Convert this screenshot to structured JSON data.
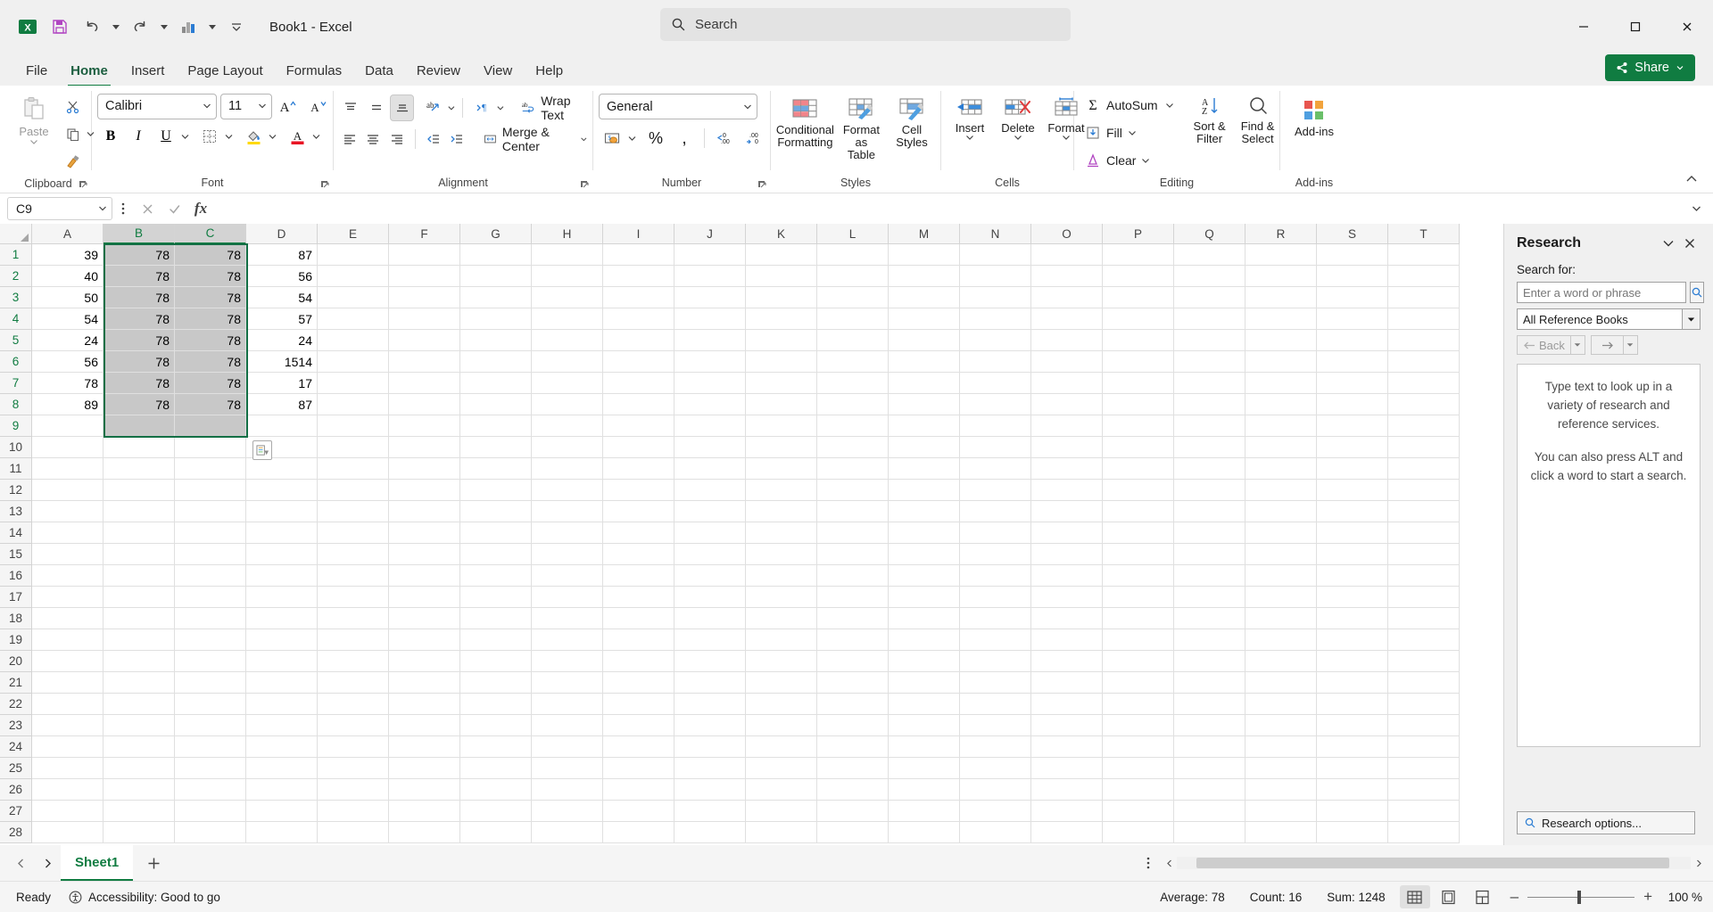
{
  "window": {
    "title": "Book1  -  Excel",
    "app_icon": "excel-icon",
    "search_placeholder": "Search",
    "minimize": "–",
    "maximize": "□",
    "close": "✕"
  },
  "quick_access": [
    {
      "name": "save",
      "icon": "save-icon"
    },
    {
      "name": "undo",
      "icon": "undo-icon"
    },
    {
      "name": "redo",
      "icon": "redo-icon"
    },
    {
      "name": "chart",
      "icon": "chart-icon"
    },
    {
      "name": "customize",
      "icon": "customize-qat-icon"
    }
  ],
  "tabs": [
    {
      "label": "File",
      "active": false
    },
    {
      "label": "Home",
      "active": true
    },
    {
      "label": "Insert",
      "active": false
    },
    {
      "label": "Page Layout",
      "active": false
    },
    {
      "label": "Formulas",
      "active": false
    },
    {
      "label": "Data",
      "active": false
    },
    {
      "label": "Review",
      "active": false
    },
    {
      "label": "View",
      "active": false
    },
    {
      "label": "Help",
      "active": false
    }
  ],
  "share_label": "Share",
  "ribbon": {
    "groups": {
      "clipboard": {
        "label": "Clipboard",
        "paste": "Paste",
        "cut": "Cut",
        "copy": "Copy",
        "format_painter": "Format Painter"
      },
      "font": {
        "label": "Font",
        "font_name": "Calibri",
        "font_size": "11",
        "grow": "Increase Font Size",
        "shrink": "Decrease Font Size",
        "bold": "B",
        "italic": "I",
        "underline": "U",
        "borders": "Borders",
        "fill_color": "Fill Color",
        "font_color": "Font Color"
      },
      "alignment": {
        "label": "Alignment",
        "wrap_text": "Wrap Text",
        "merge_center": "Merge & Center",
        "orientation": "Orientation",
        "ltr": "Text Direction",
        "decrease_indent": "Decrease Indent",
        "increase_indent": "Increase Indent"
      },
      "number": {
        "label": "Number",
        "format": "General",
        "accounting": "Accounting Number Format",
        "percent": "%",
        "comma": ",",
        "increase_decimal": "Increase Decimal",
        "decrease_decimal": "Decrease Decimal"
      },
      "styles": {
        "label": "Styles",
        "conditional_formatting": "Conditional\nFormatting",
        "conditional_formatting_l1": "Conditional",
        "conditional_formatting_l2": "Formatting",
        "format_as_table_l1": "Format as",
        "format_as_table_l2": "Table",
        "cell_styles_l1": "Cell",
        "cell_styles_l2": "Styles"
      },
      "cells": {
        "label": "Cells",
        "insert": "Insert",
        "delete": "Delete",
        "format": "Format"
      },
      "editing": {
        "label": "Editing",
        "autosum": "AutoSum",
        "fill": "Fill",
        "clear": "Clear",
        "sort_filter_l1": "Sort &",
        "sort_filter_l2": "Filter",
        "find_select_l1": "Find &",
        "find_select_l2": "Select"
      },
      "addins": {
        "label": "Add-ins",
        "button": "Add-ins"
      }
    }
  },
  "formula_bar": {
    "name_box": "C9",
    "value": "",
    "cancel_icon": "cancel-icon",
    "enter_icon": "enter-icon",
    "fx_icon": "insert-function-icon"
  },
  "grid": {
    "columns": [
      "A",
      "B",
      "C",
      "D",
      "E",
      "F",
      "G",
      "H",
      "I",
      "J",
      "K",
      "L",
      "M",
      "N",
      "O",
      "P",
      "Q",
      "R",
      "S",
      "T"
    ],
    "rows": [
      1,
      2,
      3,
      4,
      5,
      6,
      7,
      8,
      9,
      10,
      11,
      12,
      13,
      14,
      15,
      16,
      17,
      18,
      19,
      20,
      21,
      22,
      23,
      24,
      25,
      26,
      27,
      28
    ],
    "selection_range": "B1:C9",
    "selected_columns": [
      "B",
      "C"
    ],
    "data": [
      {
        "row": 1,
        "A": "39",
        "B": "78",
        "C": "78",
        "D": "87"
      },
      {
        "row": 2,
        "A": "40",
        "B": "78",
        "C": "78",
        "D": "56"
      },
      {
        "row": 3,
        "A": "50",
        "B": "78",
        "C": "78",
        "D": "54"
      },
      {
        "row": 4,
        "A": "54",
        "B": "78",
        "C": "78",
        "D": "57"
      },
      {
        "row": 5,
        "A": "24",
        "B": "78",
        "C": "78",
        "D": "24"
      },
      {
        "row": 6,
        "A": "56",
        "B": "78",
        "C": "78",
        "D": "1514"
      },
      {
        "row": 7,
        "A": "78",
        "B": "78",
        "C": "78",
        "D": "17"
      },
      {
        "row": 8,
        "A": "89",
        "B": "78",
        "C": "78",
        "D": "87"
      }
    ],
    "paste_options_icon": "paste-options-icon"
  },
  "task_pane": {
    "title": "Research",
    "collapse_icon": "chevron-down-icon",
    "close_icon": "close-icon",
    "search_label": "Search for:",
    "search_placeholder": "Enter a word or phrase",
    "search_value": "",
    "go_icon": "search-go-icon",
    "reference_source": "All Reference Books",
    "back_label": "Back",
    "forward_label": "",
    "body_paragraph_1": "Type text to look up in a variety of research and reference services.",
    "body_paragraph_2": "You can also press ALT and click a word to start a search.",
    "options_label": "Research options..."
  },
  "sheet_bar": {
    "prev": "‹",
    "next": "›",
    "sheets": [
      {
        "label": "Sheet1",
        "active": true
      }
    ],
    "add_sheet": "+",
    "more": "⋮"
  },
  "status_bar": {
    "ready": "Ready",
    "accessibility": "Accessibility: Good to go",
    "average": "Average: 78",
    "count": "Count: 16",
    "sum": "Sum: 1248",
    "views": [
      {
        "name": "normal-view",
        "active": true
      },
      {
        "name": "page-layout-view",
        "active": false
      },
      {
        "name": "page-break-view",
        "active": false
      }
    ],
    "zoom_out": "–",
    "zoom_in": "+",
    "zoom_level": "100 %"
  },
  "colors": {
    "accent": "#107c41",
    "selection_border": "#136f45",
    "selection_fill": "#c8c8c8",
    "ribbon_bg": "#ffffff",
    "chrome_bg": "#f0f0f0"
  }
}
